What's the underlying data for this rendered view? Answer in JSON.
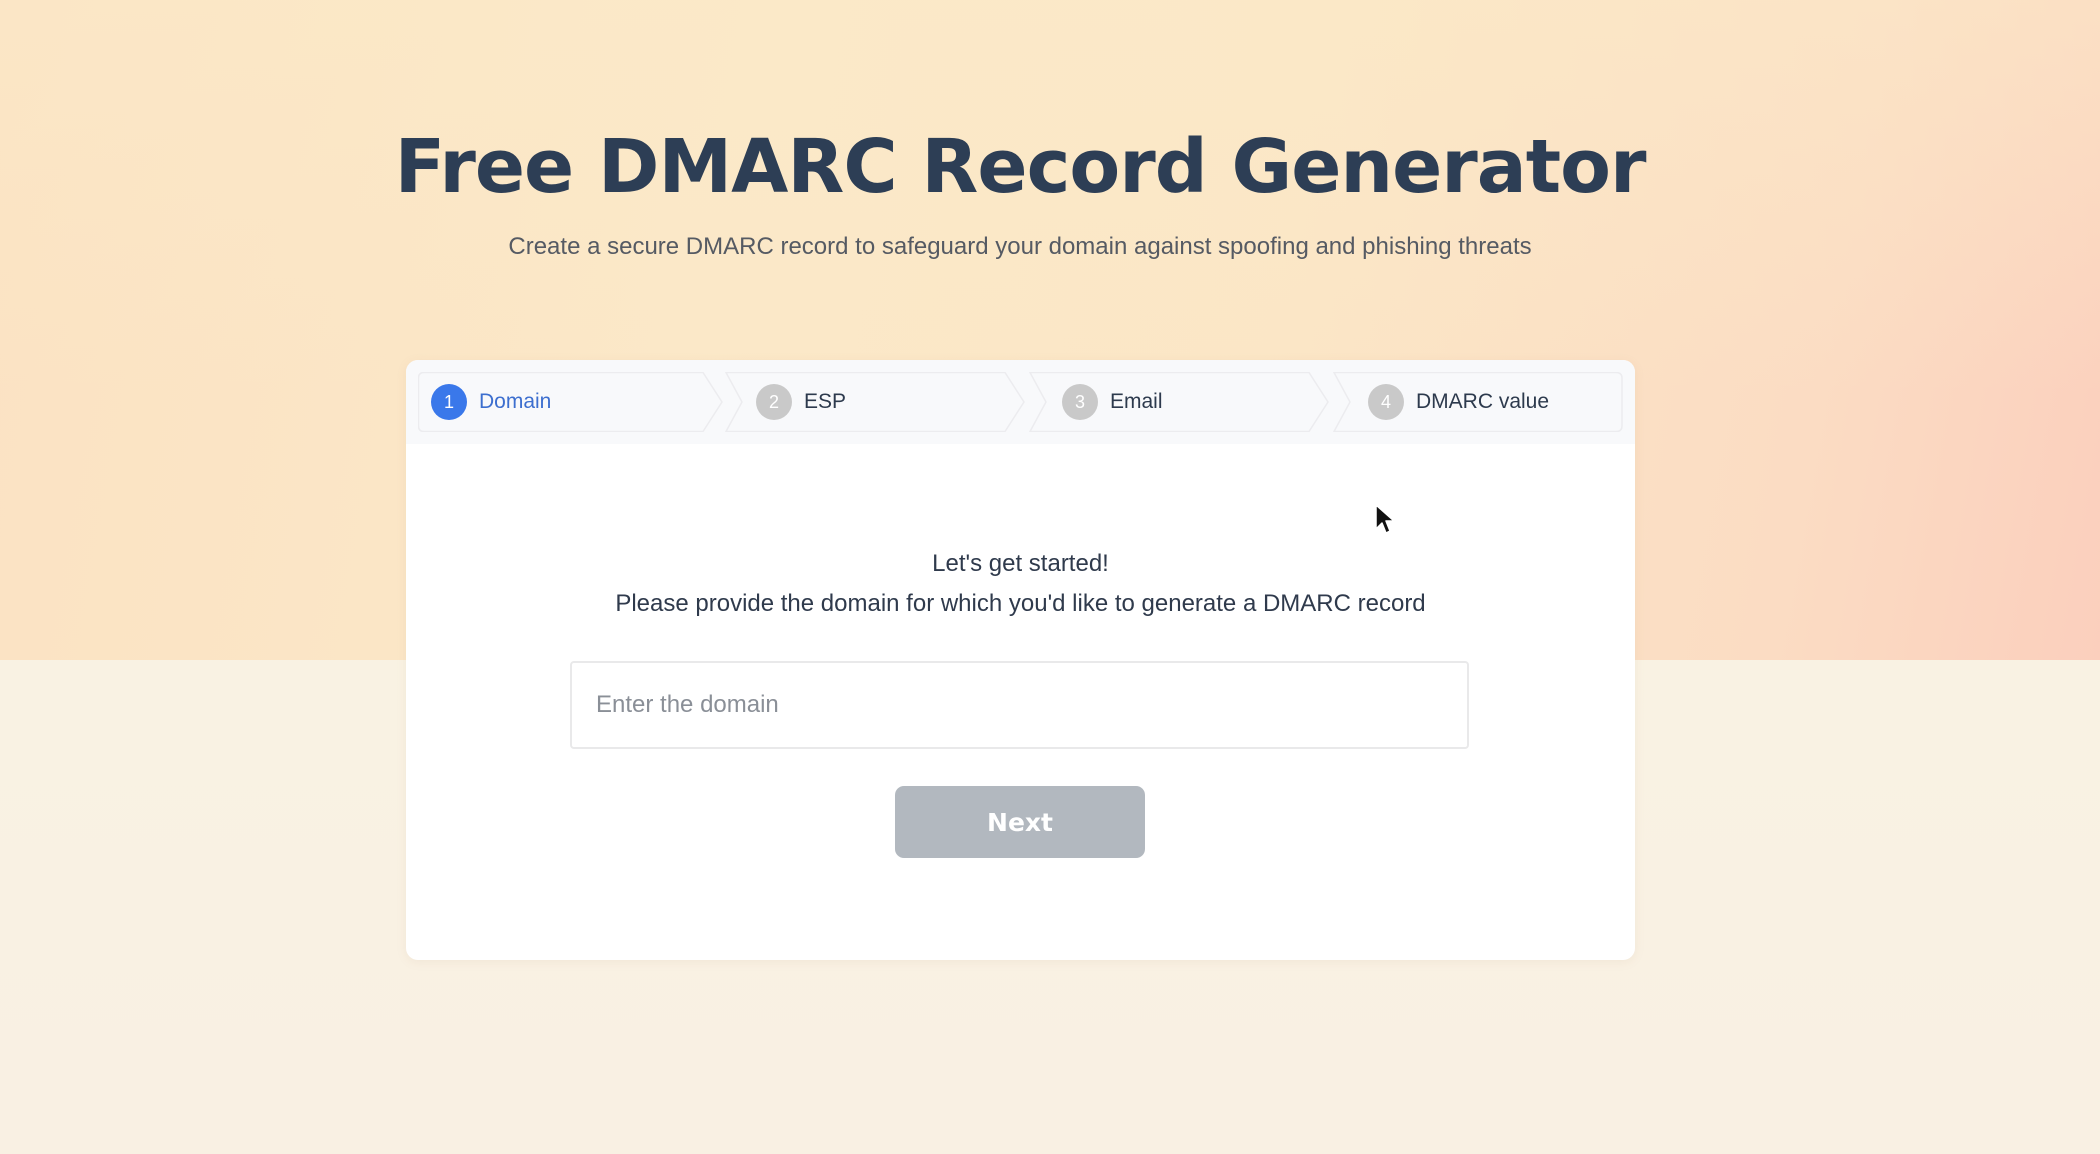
{
  "page": {
    "title": "Free DMARC Record Generator",
    "subtitle": "Create a secure DMARC record to safeguard your domain against spoofing and phishing threats"
  },
  "stepper": {
    "active_step": 1,
    "steps": [
      {
        "number": "1",
        "label": "Domain",
        "state": "active"
      },
      {
        "number": "2",
        "label": "ESP",
        "state": "inactive"
      },
      {
        "number": "3",
        "label": "Email",
        "state": "inactive"
      },
      {
        "number": "4",
        "label": "DMARC value",
        "state": "inactive"
      }
    ]
  },
  "form": {
    "intro_heading": "Let's get started!",
    "intro_text": "Please provide the domain for which you'd like to generate a DMARC record",
    "domain_input": {
      "value": "",
      "placeholder": "Enter the domain"
    },
    "next_label": "Next",
    "next_enabled": false
  },
  "colors": {
    "title": "#2d3e55",
    "accent": "#3a78ea",
    "active_step_text": "#3d6fcf",
    "inactive_step_circle": "#c9c9c9",
    "button_disabled": "#b2b8bf"
  }
}
